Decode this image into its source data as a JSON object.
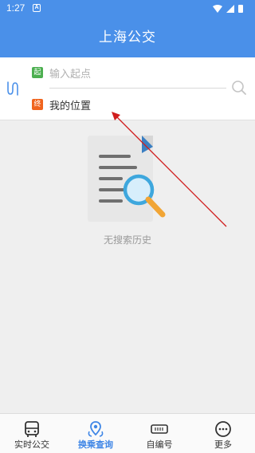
{
  "status_bar": {
    "time": "1:27",
    "notification_letter": "A"
  },
  "app": {
    "title": "上海公交"
  },
  "route": {
    "start_badge": "起",
    "start_placeholder": "输入起点",
    "end_badge": "终",
    "end_value": "我的位置"
  },
  "empty_state": {
    "message": "无搜索历史"
  },
  "tabs": [
    {
      "label": "实时公交",
      "icon": "bus-icon",
      "active": false
    },
    {
      "label": "换乘查询",
      "icon": "transfer-route-icon",
      "active": true
    },
    {
      "label": "自编号",
      "icon": "ticket-number-icon",
      "active": false
    },
    {
      "label": "更多",
      "icon": "more-dots-icon",
      "active": false
    }
  ],
  "colors": {
    "primary": "#4a90e9",
    "start_badge": "#4caf50",
    "end_badge": "#f0641e",
    "active_tab": "#3f86e6",
    "annotation_arrow": "#d01d1d"
  }
}
